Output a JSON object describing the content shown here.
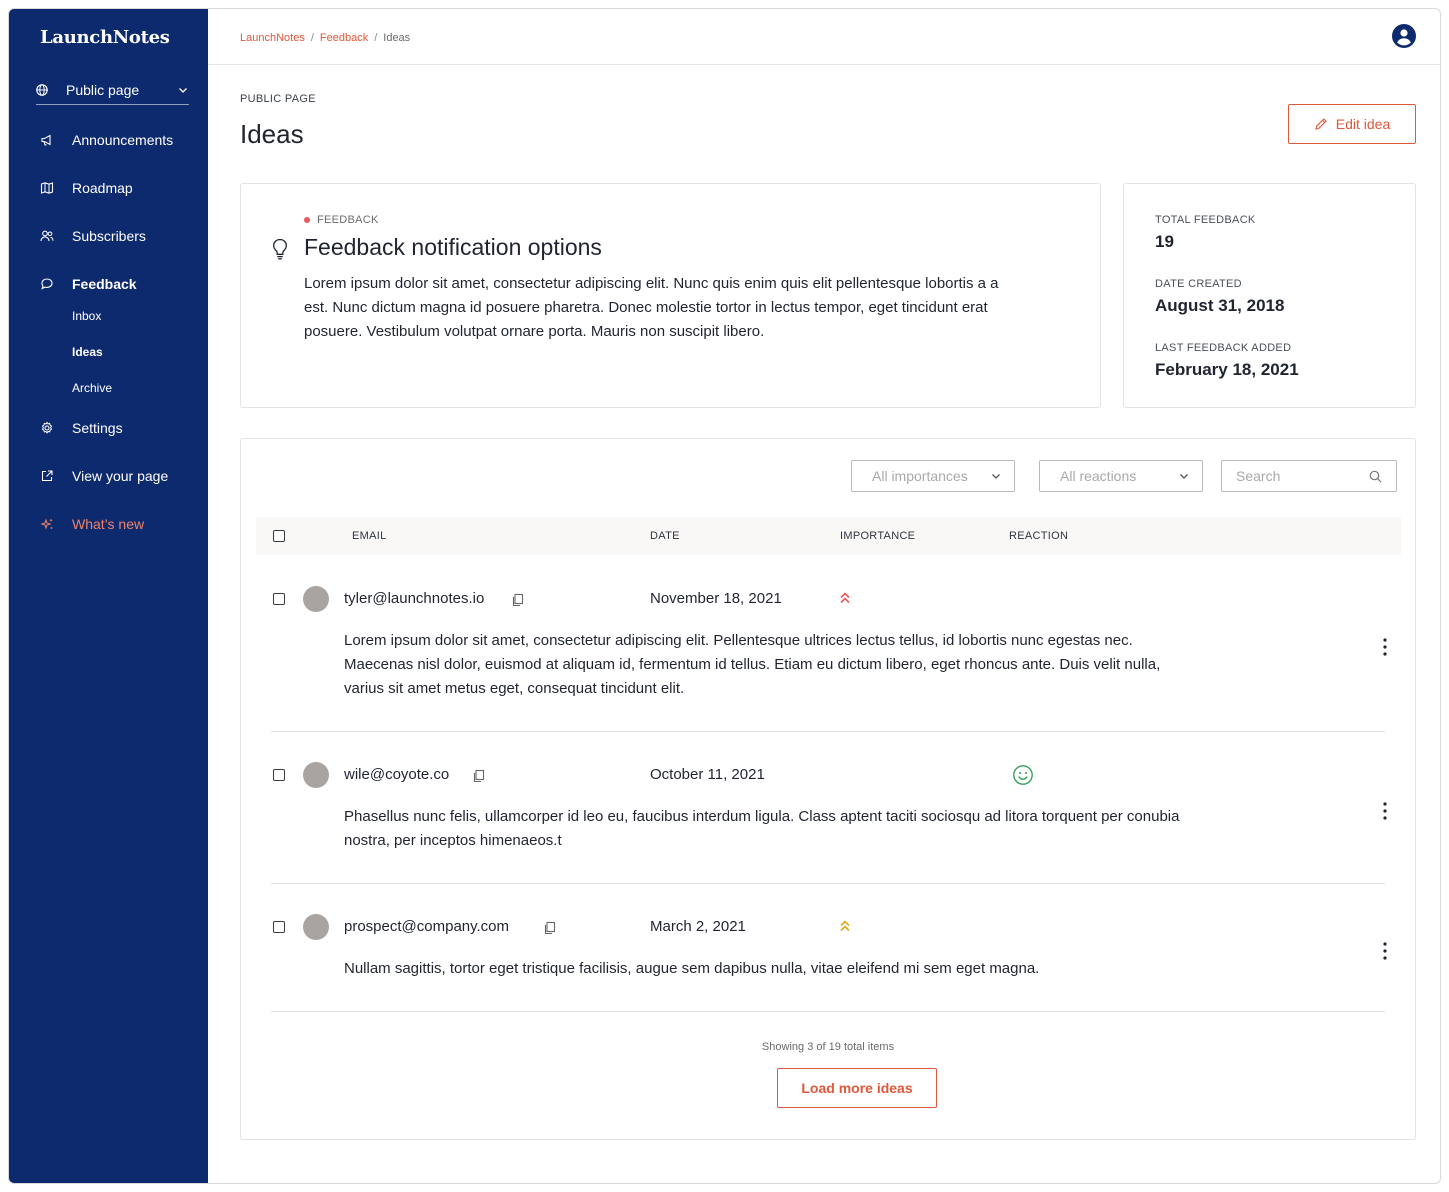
{
  "app": {
    "logo": "LaunchNotes"
  },
  "sidebar": {
    "workspace": "Public page",
    "items": [
      {
        "label": "Announcements",
        "icon": "megaphone-icon"
      },
      {
        "label": "Roadmap",
        "icon": "map-icon"
      },
      {
        "label": "Subscribers",
        "icon": "users-icon"
      },
      {
        "label": "Feedback",
        "icon": "chat-bubble-icon"
      },
      {
        "label": "Settings",
        "icon": "gear-icon"
      },
      {
        "label": "View your page",
        "icon": "external-link-icon"
      },
      {
        "label": "What’s new",
        "icon": "sparkle-icon"
      }
    ],
    "feedback_sub": [
      {
        "label": "Inbox"
      },
      {
        "label": "Ideas"
      },
      {
        "label": "Archive"
      }
    ],
    "colors": {
      "background": "#0e2a6e",
      "whats_new": "#f0826a"
    }
  },
  "breadcrumb": [
    "LaunchNotes",
    "Feedback",
    "Ideas"
  ],
  "header": {
    "eyebrow": "PUBLIC PAGE",
    "title": "Ideas",
    "edit_button": "Edit idea"
  },
  "idea": {
    "tag": "FEEDBACK",
    "title": "Feedback notification options",
    "description": "Lorem ipsum dolor sit amet, consectetur adipiscing elit. Nunc quis enim quis elit pellentesque lobortis a a est. Nunc dictum magna id posuere pharetra. Donec molestie tortor in lectus tempor, eget tincidunt erat posuere. Vestibulum volutpat ornare porta. Mauris non suscipit libero."
  },
  "stats": [
    {
      "label": "TOTAL FEEDBACK",
      "value": "19"
    },
    {
      "label": "DATE CREATED",
      "value": "August 31, 2018"
    },
    {
      "label": "LAST FEEDBACK ADDED",
      "value": "February 18, 2021"
    }
  ],
  "filters": {
    "importance": "All importances",
    "reaction": "All reactions",
    "search_placeholder": "Search"
  },
  "table": {
    "headers": {
      "email": "EMAIL",
      "date": "DATE",
      "importance": "IMPORTANCE",
      "reaction": "REACTION"
    },
    "rows": [
      {
        "email": "tyler@launchnotes.io",
        "date": "November 18, 2021",
        "importance_icon": "double-chevron-up-icon",
        "importance_color": "#e85a5a",
        "reaction_icon": "",
        "text": "Lorem ipsum dolor sit amet, consectetur adipiscing elit. Pellentesque ultrices lectus tellus, id lobortis nunc egestas nec. Maecenas nisl dolor, euismod at aliquam id, fermentum id tellus. Etiam eu dictum libero, eget rhoncus ante. Duis velit nulla, varius sit amet metus eget, consequat tincidunt elit."
      },
      {
        "email": "wile@coyote.co",
        "date": "October 11, 2021",
        "importance_icon": "",
        "reaction_icon": "smiley-face-icon",
        "reaction_color": "#2e9e4f",
        "text": "Phasellus nunc felis, ullamcorper id leo eu, faucibus interdum ligula. Class aptent taciti sociosqu ad litora torquent per conubia nostra, per inceptos himenaeos.t"
      },
      {
        "email": "prospect@company.com",
        "date": "March 2, 2021",
        "importance_icon": "double-chevron-up-icon",
        "importance_color": "#e0a81b",
        "reaction_icon": "",
        "text": "Nullam sagittis, tortor eget tristique facilisis, augue sem dapibus nulla, vitae eleifend mi sem eget magna."
      }
    ]
  },
  "pagination": {
    "showing_prefix": "Showing",
    "shown": "3",
    "of_word": "of",
    "total": "19",
    "suffix": "total items",
    "load_more": "Load more ideas"
  },
  "colors": {
    "accent": "#e0583b",
    "avatar_placeholder": "#a9a4a0"
  }
}
